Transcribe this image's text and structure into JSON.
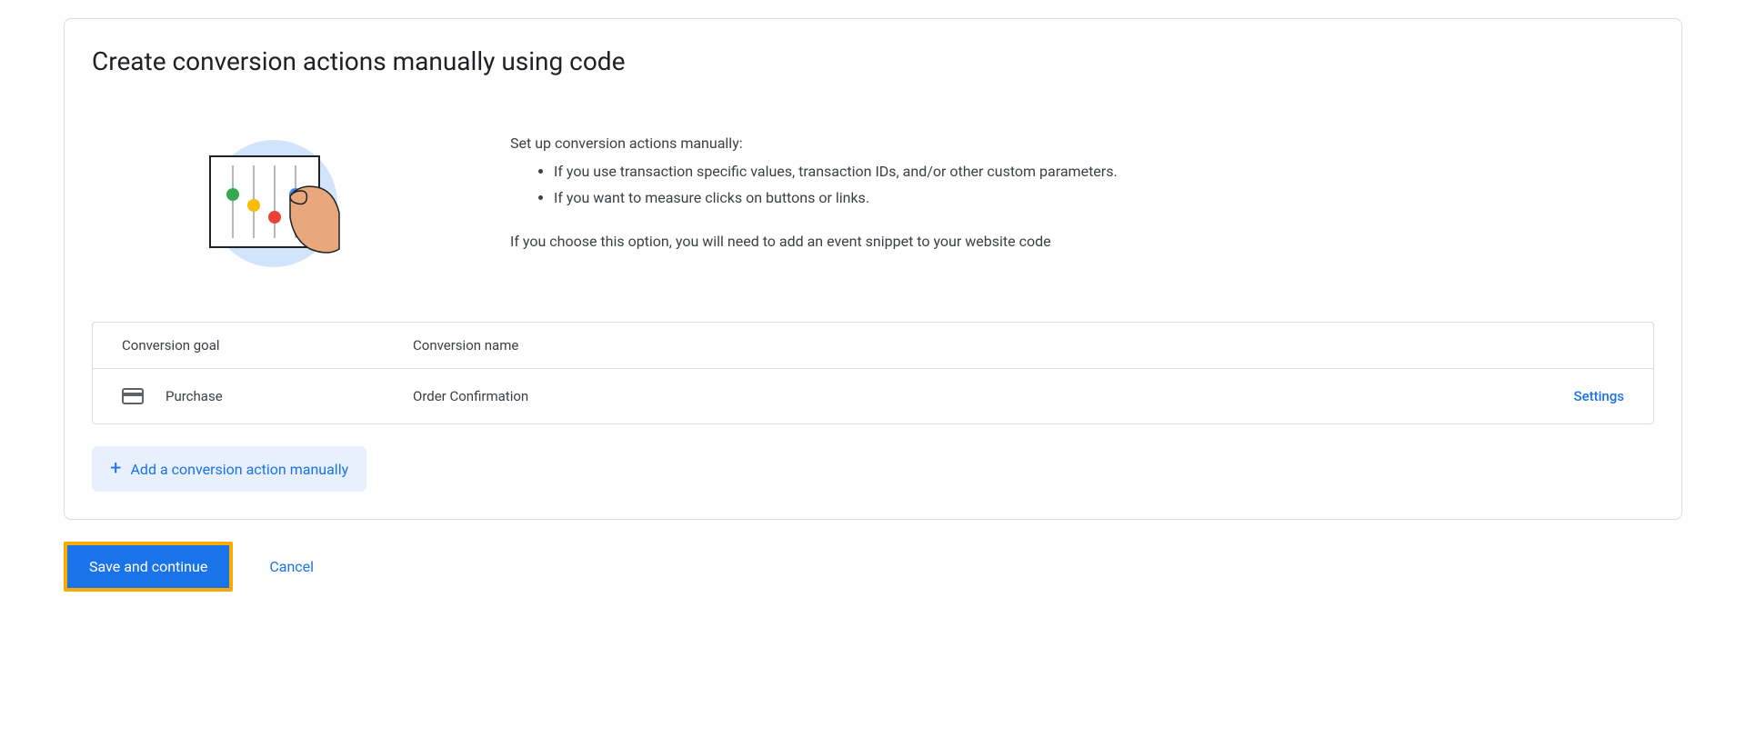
{
  "card": {
    "title": "Create conversion actions manually using code",
    "intro": {
      "lead": "Set up conversion actions manually:",
      "bullets": [
        "If you use transaction specific values, transaction IDs, and/or other custom parameters.",
        "If you want to measure clicks on buttons or links."
      ],
      "note": "If you choose this option, you will need to add an event snippet to your website code"
    },
    "table": {
      "headers": {
        "goal": "Conversion goal",
        "name": "Conversion name"
      },
      "rows": [
        {
          "goal": "Purchase",
          "name": "Order Confirmation",
          "action": "Settings"
        }
      ]
    },
    "add_button": "Add a conversion action manually"
  },
  "footer": {
    "save": "Save and continue",
    "cancel": "Cancel"
  }
}
